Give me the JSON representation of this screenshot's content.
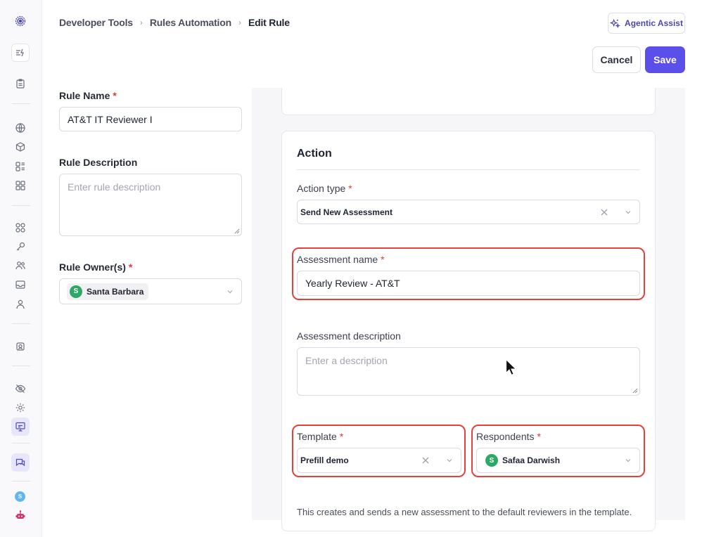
{
  "breadcrumb": {
    "items": [
      "Developer Tools",
      "Rules Automation"
    ],
    "current": "Edit Rule"
  },
  "header": {
    "agentic_label": "Agentic Assist",
    "cancel_label": "Cancel",
    "save_label": "Save",
    "accent_color": "#5b4fe9"
  },
  "left_form": {
    "rule_name_label": "Rule Name",
    "rule_name_value": "AT&T IT Reviewer I",
    "rule_description_label": "Rule Description",
    "rule_description_placeholder": "Enter rule description",
    "rule_owner_label": "Rule Owner(s)",
    "rule_owner_avatar": "S",
    "rule_owner_value": "Santa Barbara"
  },
  "action": {
    "title": "Action",
    "action_type_label": "Action type",
    "action_type_value": "Send New Assessment",
    "assessment_name_label": "Assessment name",
    "assessment_name_value": "Yearly Review - AT&T",
    "assessment_description_label": "Assessment description",
    "assessment_description_placeholder": "Enter a description",
    "template_label": "Template",
    "template_value": "Prefill demo",
    "respondents_label": "Respondents",
    "respondent_avatar": "S",
    "respondent_value": "Safaa Darwish",
    "footnote": "This creates and sends a new assessment to the default reviewers in the template."
  },
  "rail": {
    "avatar_letter": "S",
    "icons": [
      "logo-icon",
      "automation-icon",
      "clipboard-icon",
      "globe-icon",
      "cube-icon",
      "apps-list-icon",
      "grid-icon",
      "integrations-icon",
      "key-icon",
      "users-icon",
      "inbox-icon",
      "person-icon",
      "vendor-icon",
      "eye-off-icon",
      "settings-icon",
      "presentation-icon",
      "chat-icon",
      "robot-icon"
    ]
  }
}
